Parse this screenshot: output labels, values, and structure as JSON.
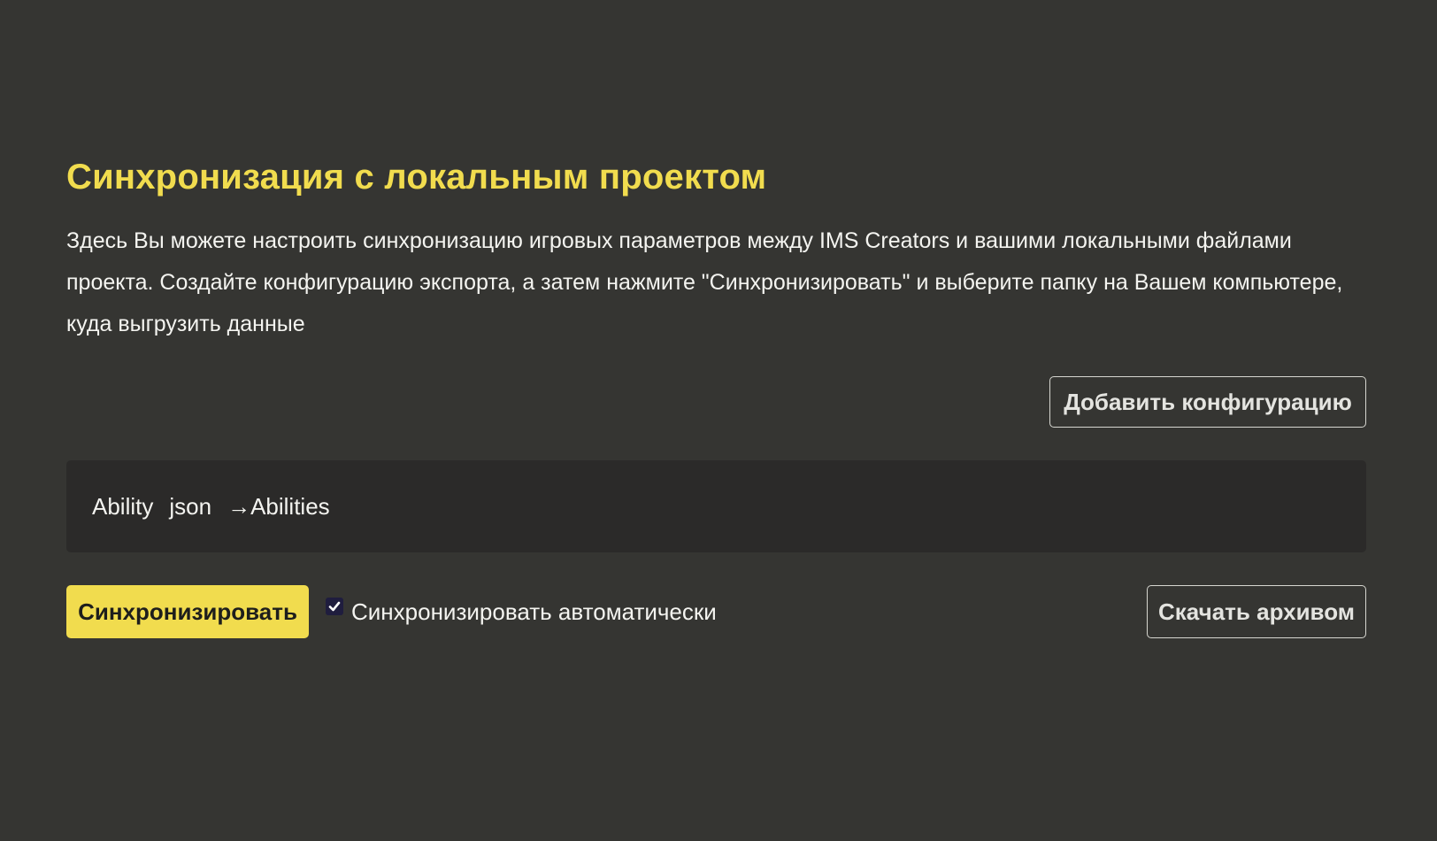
{
  "section": {
    "title": "Синхронизация с локальным проектом",
    "description": "Здесь Вы можете настроить синхронизацию игровых параметров между IMS Creators и вашими локальными файлами проекта. Создайте конфигурацию экспорта, а затем нажмите \"Синхронизировать\" и выберите папку на Вашем компьютере, куда выгрузить данные"
  },
  "toolbar": {
    "add_config_label": "Добавить конфигурацию"
  },
  "configs": [
    {
      "entity": "Ability",
      "format": "json",
      "arrow": "→",
      "target": "Abilities"
    }
  ],
  "actions": {
    "sync_label": "Синхронизировать",
    "auto_sync_label": "Синхронизировать автоматически",
    "auto_sync_checked": true,
    "download_label": "Скачать архивом"
  },
  "icons": {
    "checkbox": "check-icon"
  },
  "colors": {
    "background": "#353532",
    "accent": "#f1dc4e",
    "card": "#2b2a29",
    "text": "#f4f4f0"
  }
}
